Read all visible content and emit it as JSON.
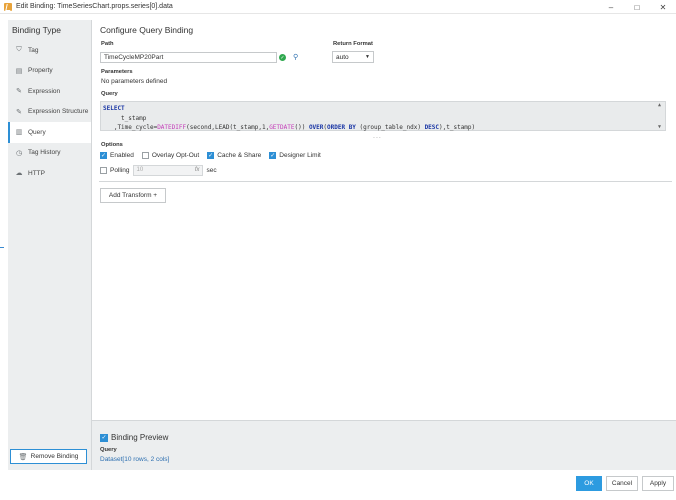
{
  "window": {
    "title": "Edit Binding: TimeSeriesChart.props.series[0].data",
    "controls": [
      "minimize",
      "maximize",
      "close"
    ]
  },
  "sidebar": {
    "heading": "Binding Type",
    "items": [
      {
        "label": "Tag",
        "icon": "tag-icon",
        "glyph": "⛉",
        "active": false
      },
      {
        "label": "Property",
        "icon": "property-icon",
        "glyph": "▤",
        "active": false
      },
      {
        "label": "Expression",
        "icon": "expression-icon",
        "glyph": "✎",
        "active": false
      },
      {
        "label": "Expression Structure",
        "icon": "expression-structure-icon",
        "glyph": "✎",
        "active": false
      },
      {
        "label": "Query",
        "icon": "query-icon",
        "glyph": "▥",
        "active": true
      },
      {
        "label": "Tag History",
        "icon": "tag-history-icon",
        "glyph": "◷",
        "active": false
      },
      {
        "label": "HTTP",
        "icon": "http-icon",
        "glyph": "☁",
        "active": false
      }
    ],
    "remove_label": "Remove Binding"
  },
  "main": {
    "title": "Configure Query Binding",
    "path_label": "Path",
    "path_value": "TimeCycleMP20Part",
    "return_format_label": "Return Format",
    "return_format_value": "auto",
    "parameters_label": "Parameters",
    "parameters_text": "No parameters defined",
    "query_label": "Query",
    "query_lines": [
      "SELECT",
      "     t_stamp",
      "   ,Time_cycle=DATEDIFF(second,LEAD(t_stamp,1,GETDATE()) OVER(ORDER BY (group_table_ndx) DESC),t_stamp)"
    ],
    "query_ellipsis": "...",
    "options_label": "Options",
    "options": [
      {
        "label": "Enabled",
        "checked": true
      },
      {
        "label": "Overlay Opt-Out",
        "checked": false
      },
      {
        "label": "Cache & Share",
        "checked": true
      },
      {
        "label": "Designer Limit",
        "checked": true
      }
    ],
    "polling_label": "Polling",
    "polling_checked": false,
    "polling_value": "10",
    "polling_fx": "fx",
    "polling_unit": "sec",
    "add_transform_label": "Add Transform +"
  },
  "preview": {
    "label": "Binding Preview",
    "checked": true,
    "query_label": "Query",
    "dataset_text": "Dataset[10 rows, 2 cols]"
  },
  "footer": {
    "ok_label": "OK",
    "cancel_label": "Cancel",
    "apply_label": "Apply"
  },
  "colors": {
    "accent": "#2d8fd5",
    "primary_button": "#2d9be0",
    "sidebar_bg": "#eceeef",
    "query_bg": "#e9ebec",
    "sql_keyword": "#1a36a5",
    "sql_function": "#c43bb8",
    "success": "#2fa84f"
  }
}
